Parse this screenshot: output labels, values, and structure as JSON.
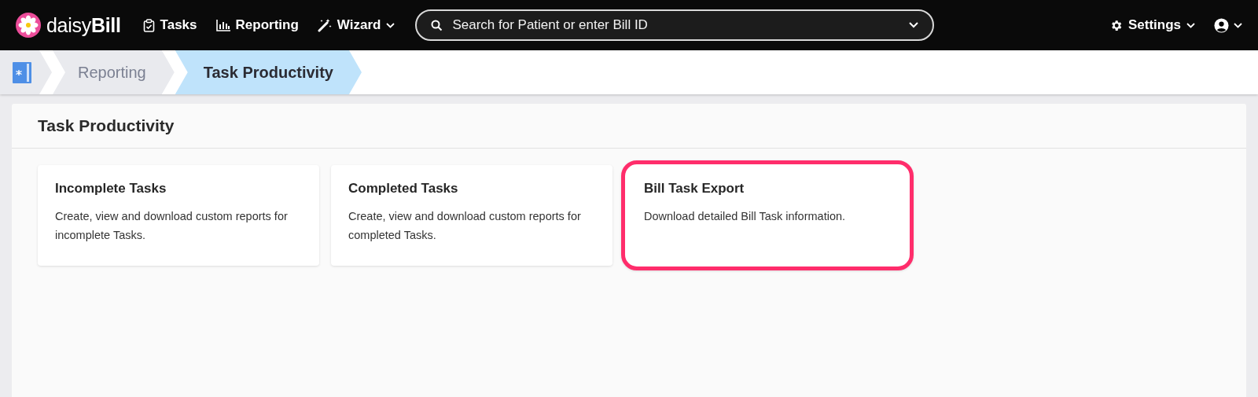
{
  "navbar": {
    "logo": "daisy**Bill**",
    "items": [
      {
        "label": "Tasks",
        "kind": "tasks",
        "dropdown": false
      },
      {
        "label": "Reporting",
        "kind": "reporting",
        "dropdown": false
      },
      {
        "label": "Wizard",
        "kind": "wizard",
        "dropdown": true
      }
    ],
    "search": {
      "placeholder": "Search for Patient or enter Bill ID"
    },
    "settings": {
      "label": "Settings"
    }
  },
  "breadcrumb": [
    {
      "label": "Reporting",
      "selected": false
    },
    {
      "label": "Task Productivity",
      "selected": true
    }
  ],
  "page": {
    "title": "Task Productivity"
  },
  "cards": [
    {
      "title": "Incomplete Tasks",
      "description": "Create, view and download custom reports for incomplete Tasks.",
      "highlighted": false
    },
    {
      "title": "Completed Tasks",
      "description": "Create, view and download custom reports for completed Tasks.",
      "highlighted": false
    },
    {
      "title": "Bill Task Export",
      "description": "Download detailed Bill Task information.",
      "highlighted": true
    }
  ]
}
